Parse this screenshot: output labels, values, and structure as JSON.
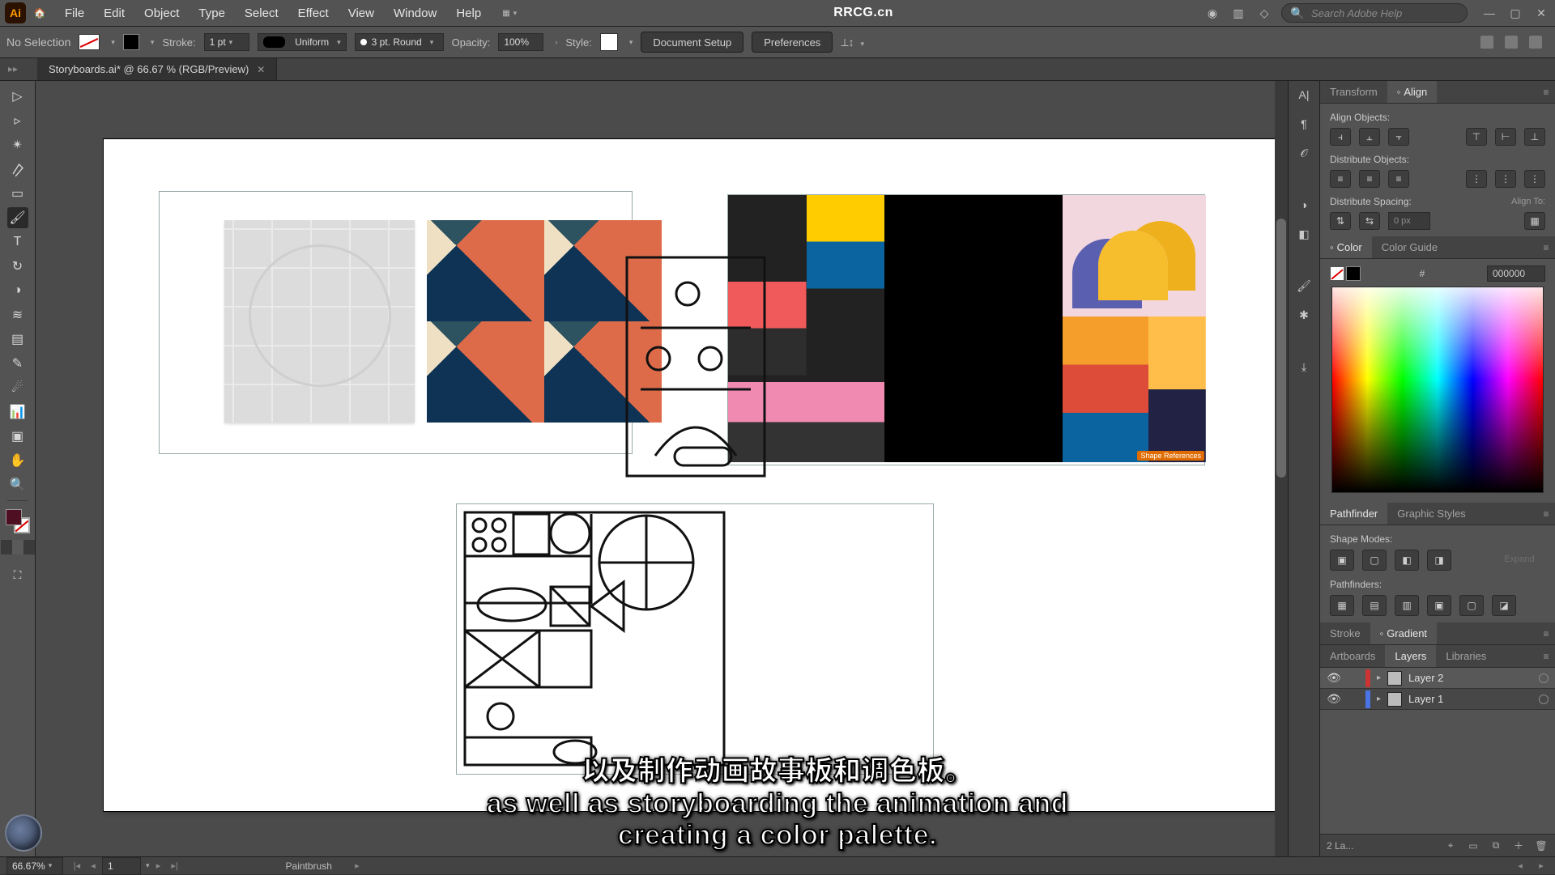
{
  "app": {
    "title": "RRCG.cn",
    "logo_text": "Ai",
    "menus": [
      "File",
      "Edit",
      "Object",
      "Type",
      "Select",
      "Effect",
      "View",
      "Window",
      "Help"
    ],
    "search_placeholder": "Search Adobe Help"
  },
  "control": {
    "selection_state": "No Selection",
    "labels": {
      "stroke": "Stroke:",
      "opacity": "Opacity:",
      "style": "Style:"
    },
    "stroke_weight": "1 pt",
    "stroke_profile": "Uniform",
    "brush_definition": "3 pt. Round",
    "opacity": "100%",
    "buttons": {
      "document_setup": "Document Setup",
      "preferences": "Preferences"
    }
  },
  "document": {
    "tab_title": "Storyboards.ai* @ 66.67 % (RGB/Preview)"
  },
  "panels": {
    "align": {
      "tabs": {
        "transform": "Transform",
        "align": "Align"
      },
      "labels": {
        "align_objects": "Align Objects:",
        "distribute_objects": "Distribute Objects:",
        "distribute_spacing": "Distribute Spacing:",
        "align_to": "Align To:"
      },
      "spacing_value": "0 px"
    },
    "color": {
      "tabs": {
        "color": "Color",
        "guide": "Color Guide"
      },
      "hex": "000000"
    },
    "pathfinder": {
      "tabs": {
        "pathfinder": "Pathfinder",
        "graphic_styles": "Graphic Styles"
      },
      "labels": {
        "shape_modes": "Shape Modes:",
        "pathfinders": "Pathfinders:"
      },
      "expand_label": "Expand"
    },
    "stroke_gradient": {
      "stroke": "Stroke",
      "gradient": "Gradient"
    },
    "layers": {
      "tabs": {
        "artboards": "Artboards",
        "layers": "Layers",
        "libraries": "Libraries"
      },
      "items": [
        {
          "name": "Layer 2",
          "color": "#c33",
          "selected": true
        },
        {
          "name": "Layer 1",
          "color": "#4a74e6",
          "selected": false
        }
      ],
      "footer_count": "2 La..."
    }
  },
  "status": {
    "zoom": "66.67%",
    "artboard_num": "1",
    "tool": "Paintbrush"
  },
  "subtitles": {
    "cn": "以及制作动画故事板和调色板。",
    "en1": "as well as storyboarding the animation and",
    "en2": "creating a color palette."
  },
  "canvas": {
    "ref_tag": "Shape References"
  }
}
